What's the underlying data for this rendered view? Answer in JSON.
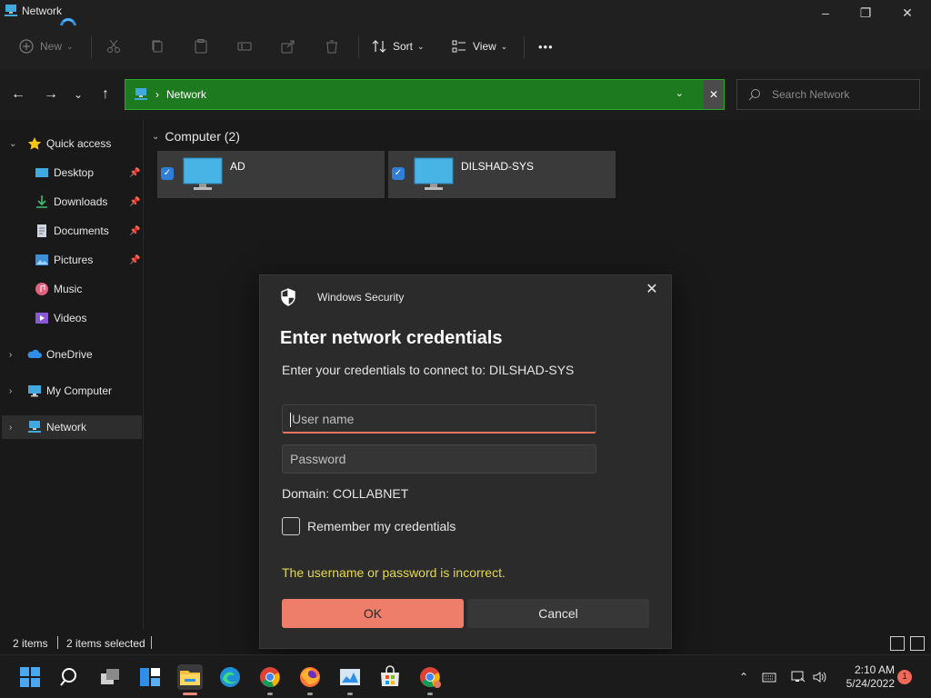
{
  "window": {
    "title": "Network"
  },
  "toolbar": {
    "new_label": "New",
    "sort_label": "Sort",
    "view_label": "View",
    "more_label": "•••"
  },
  "address": {
    "crumb": "Network",
    "search_placeholder": "Search Network"
  },
  "sidebar": {
    "items": [
      {
        "label": "Quick access",
        "icon": "star-icon",
        "pinned": false
      },
      {
        "label": "Desktop",
        "icon": "desktop-icon",
        "pinned": true
      },
      {
        "label": "Downloads",
        "icon": "downloads-icon",
        "pinned": true
      },
      {
        "label": "Documents",
        "icon": "documents-icon",
        "pinned": true
      },
      {
        "label": "Pictures",
        "icon": "pictures-icon",
        "pinned": true
      },
      {
        "label": "Music",
        "icon": "music-icon",
        "pinned": false
      },
      {
        "label": "Videos",
        "icon": "videos-icon",
        "pinned": false
      },
      {
        "label": "OneDrive",
        "icon": "onedrive-icon",
        "pinned": false
      },
      {
        "label": "My Computer",
        "icon": "computer-icon",
        "pinned": false
      },
      {
        "label": "Network",
        "icon": "network-icon",
        "pinned": false
      }
    ]
  },
  "content": {
    "group_header": "Computer (2)",
    "computers": [
      {
        "name": "AD",
        "selected": true
      },
      {
        "name": "DILSHAD-SYS",
        "selected": true
      }
    ]
  },
  "status": {
    "items_count": "2 items",
    "selected_count": "2 items selected"
  },
  "dialog": {
    "title": "Windows Security",
    "heading": "Enter network credentials",
    "subtext": "Enter your credentials to connect to: DILSHAD-SYS",
    "username_placeholder": "User name",
    "password_placeholder": "Password",
    "domain": "Domain: COLLABNET",
    "remember_label": "Remember my credentials",
    "remember_checked": false,
    "error": "The username or password is incorrect.",
    "ok_label": "OK",
    "cancel_label": "Cancel"
  },
  "taskbar": {
    "time": "2:10 AM",
    "date": "5/24/2022",
    "notification_count": "1"
  },
  "colors": {
    "address_bg": "#1e7a1e",
    "accent": "#ee7d6a",
    "error_text": "#e4d94e",
    "checkbox_accent": "#2f7fd8"
  }
}
